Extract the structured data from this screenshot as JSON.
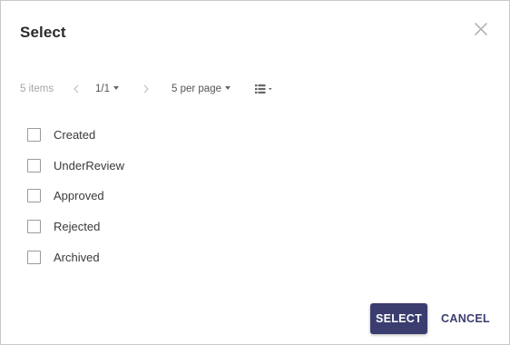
{
  "dialog": {
    "title": "Select",
    "close_icon": "close-icon"
  },
  "toolbar": {
    "item_count": "5 items",
    "page": "1/1",
    "per_page": "5 per page",
    "view_icon": "list-view-icon"
  },
  "items": [
    {
      "label": "Created",
      "checked": false
    },
    {
      "label": "UnderReview",
      "checked": false
    },
    {
      "label": "Approved",
      "checked": false
    },
    {
      "label": "Rejected",
      "checked": false
    },
    {
      "label": "Archived",
      "checked": false
    }
  ],
  "actions": {
    "select_label": "SELECT",
    "cancel_label": "CANCEL"
  },
  "colors": {
    "primary": "#3a3d6e",
    "border": "#c9c9c9",
    "muted_text": "#9a9a9a"
  }
}
